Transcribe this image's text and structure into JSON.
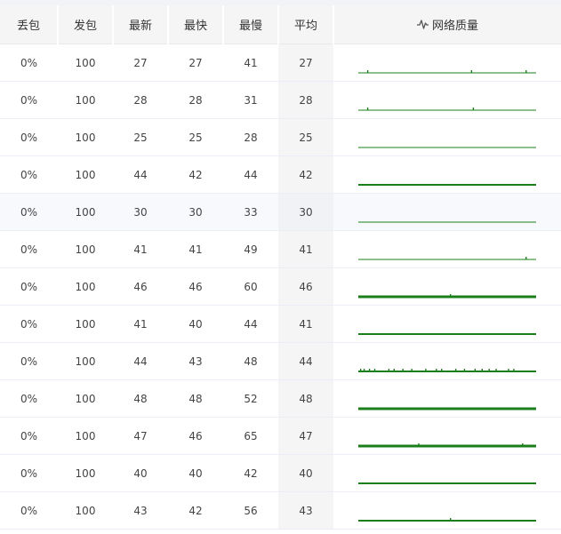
{
  "headers": {
    "loss": "丢包",
    "sent": "发包",
    "latest": "最新",
    "fastest": "最快",
    "slowest": "最慢",
    "average": "平均",
    "quality": "网络质量"
  },
  "colors": {
    "sparkline": "#1a7f1a",
    "header_bg": "#f5f5f5",
    "avg_bg": "#f5f5f5"
  },
  "rows": [
    {
      "loss": "0%",
      "sent": "100",
      "latest": "27",
      "fastest": "27",
      "slowest": "41",
      "average": "27",
      "stroke": 1,
      "ticks": [
        0.05,
        0.64,
        0.95
      ]
    },
    {
      "loss": "0%",
      "sent": "100",
      "latest": "28",
      "fastest": "28",
      "slowest": "31",
      "average": "28",
      "stroke": 1,
      "ticks": [
        0.05,
        0.65
      ]
    },
    {
      "loss": "0%",
      "sent": "100",
      "latest": "25",
      "fastest": "25",
      "slowest": "28",
      "average": "25",
      "stroke": 1,
      "ticks": []
    },
    {
      "loss": "0%",
      "sent": "100",
      "latest": "44",
      "fastest": "42",
      "slowest": "44",
      "average": "42",
      "stroke": 2,
      "ticks": []
    },
    {
      "loss": "0%",
      "sent": "100",
      "latest": "30",
      "fastest": "30",
      "slowest": "33",
      "average": "30",
      "stroke": 1,
      "ticks": []
    },
    {
      "loss": "0%",
      "sent": "100",
      "latest": "41",
      "fastest": "41",
      "slowest": "49",
      "average": "41",
      "stroke": 1,
      "ticks": [
        0.95
      ]
    },
    {
      "loss": "0%",
      "sent": "100",
      "latest": "46",
      "fastest": "46",
      "slowest": "60",
      "average": "46",
      "stroke": 3,
      "ticks": [
        0.52
      ]
    },
    {
      "loss": "0%",
      "sent": "100",
      "latest": "41",
      "fastest": "40",
      "slowest": "44",
      "average": "41",
      "stroke": 2,
      "ticks": []
    },
    {
      "loss": "0%",
      "sent": "100",
      "latest": "44",
      "fastest": "43",
      "slowest": "48",
      "average": "44",
      "stroke": 2,
      "ticks": [
        0.01,
        0.03,
        0.06,
        0.09,
        0.17,
        0.2,
        0.25,
        0.3,
        0.38,
        0.44,
        0.47,
        0.55,
        0.6,
        0.66,
        0.7,
        0.74,
        0.78,
        0.85,
        0.88
      ]
    },
    {
      "loss": "0%",
      "sent": "100",
      "latest": "48",
      "fastest": "48",
      "slowest": "52",
      "average": "48",
      "stroke": 3,
      "ticks": []
    },
    {
      "loss": "0%",
      "sent": "100",
      "latest": "47",
      "fastest": "46",
      "slowest": "65",
      "average": "47",
      "stroke": 3,
      "ticks": [
        0.34,
        0.93
      ]
    },
    {
      "loss": "0%",
      "sent": "100",
      "latest": "40",
      "fastest": "40",
      "slowest": "42",
      "average": "40",
      "stroke": 2,
      "ticks": []
    },
    {
      "loss": "0%",
      "sent": "100",
      "latest": "43",
      "fastest": "42",
      "slowest": "56",
      "average": "43",
      "stroke": 2,
      "ticks": [
        0.52
      ]
    }
  ],
  "highlight_row": 4
}
